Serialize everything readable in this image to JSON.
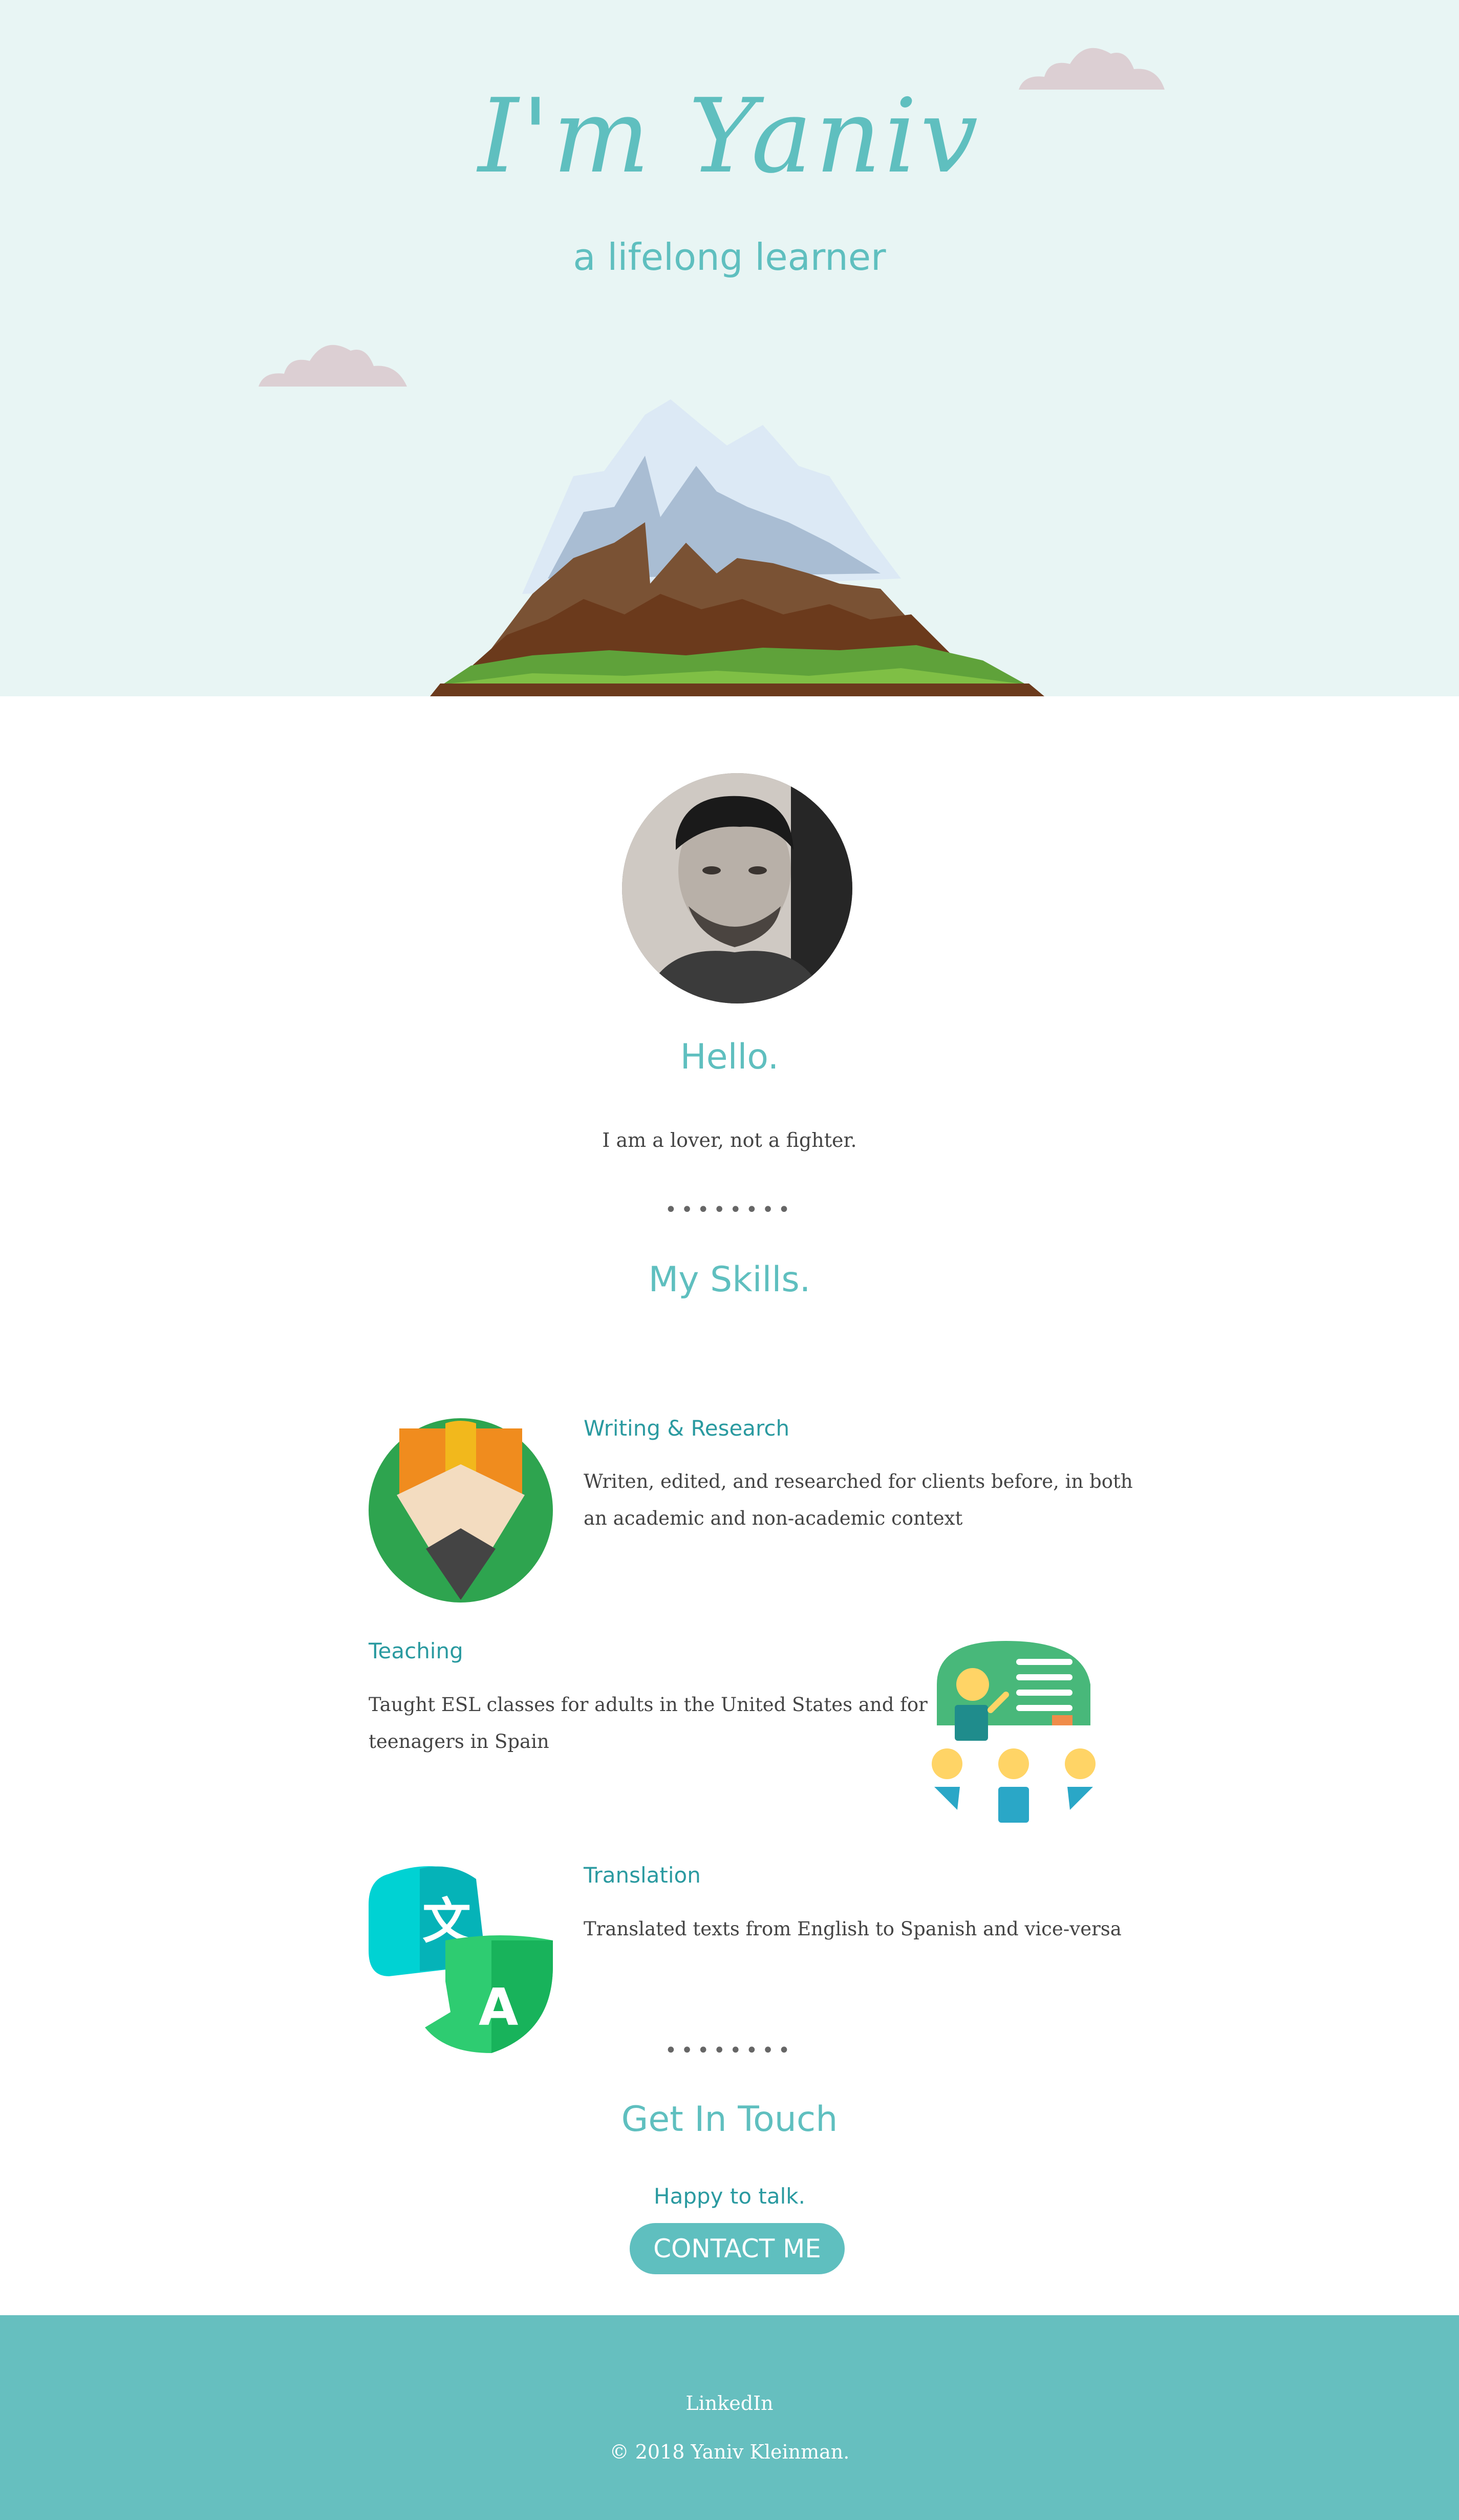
{
  "hero": {
    "title": "I'm Yaniv",
    "subtitle": "a lifelong learner"
  },
  "about": {
    "title": "Hello.",
    "text": "I am a lover, not a fighter."
  },
  "divider": "••••••••",
  "skills": {
    "title": "My Skills.",
    "items": [
      {
        "title": "Writing & Research",
        "desc_line1": "Writen, edited, and researched for clients before, in both",
        "desc_line2": "an academic and non-academic context",
        "icon": "pencil-icon"
      },
      {
        "title": "Teaching",
        "desc_line1": "Taught ESL classes for adults in the United States and for",
        "desc_line2": "teenagers in Spain",
        "icon": "classroom-icon"
      },
      {
        "title": "Translation",
        "desc_line1": "Translated texts from English to Spanish and vice-versa",
        "desc_line2": "",
        "icon": "translate-icon"
      }
    ]
  },
  "contact": {
    "title": "Get In Touch",
    "subtitle": "Happy to talk.",
    "button": "CONTACT ME"
  },
  "footer": {
    "link": "LinkedIn",
    "copyright": "© 2018 Yaniv Kleinman."
  },
  "colors": {
    "accent": "#5fbfbf",
    "hero_bg": "#e8f5f4",
    "footer_bg": "#66bfbf",
    "skill_title": "#2a9aa0"
  }
}
